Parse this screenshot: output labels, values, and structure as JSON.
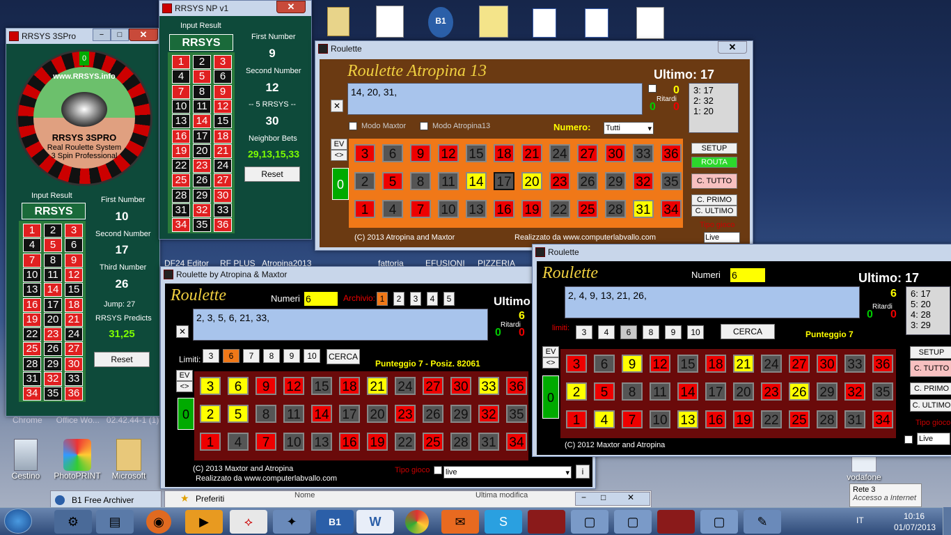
{
  "desktop": {
    "top_icons": [
      "",
      "",
      "B1",
      "",
      "",
      "",
      ""
    ],
    "labels": [
      "Cestino",
      "PhotoPRINT",
      "Microsoft",
      "vodafone",
      "fattoria",
      "EFUSIONI",
      "PIZZERIA",
      "DF24 Editor",
      "RF PLUS",
      "Atropina2013"
    ],
    "chrome_row": "Chrome      Office Wo...   02.42.44-1 (1)"
  },
  "rrsys3": {
    "title": "RRSYS 3SPro",
    "wheel_url": "www.RRSYS.info",
    "brand": "RRSYS 3SPRO",
    "tag1": "Real Roulette System",
    "tag2": "3 Spin Professional",
    "input_result": "Input Result",
    "logo": "RRSYS",
    "first_label": "First Number",
    "first": "10",
    "second_label": "Second Number",
    "second": "17",
    "third_label": "Third Number",
    "third": "26",
    "jump_label": "Jump:",
    "jump": "27",
    "predicts_label": "RRSYS Predicts",
    "predicts": "31,25",
    "reset": "Reset"
  },
  "rrsysnp": {
    "title": "RRSYS NP v1",
    "input_result": "Input Result",
    "logo": "RRSYS",
    "first_label": "First Number",
    "first": "9",
    "second_label": "Second Number",
    "second": "12",
    "mid": "-- 5 RRSYS --",
    "third": "30",
    "neighbor_label": "Neighbor Bets",
    "neighbor": "29,13,15,33",
    "reset": "Reset"
  },
  "atropina": {
    "title": "Roulette",
    "heading": "Roulette Atropina 13",
    "ultimo": "Ultimo: 17",
    "numbers": "14, 20, 31,",
    "ritardi": "Ritardi",
    "c1": "0",
    "c2": "0",
    "c3": "0",
    "history": [
      "3:  17",
      "2:  32",
      "1:  20"
    ],
    "modo_maxtor": "Modo Maxtor",
    "modo_atropina": "Modo Atropina13",
    "numero_label": "Numero:",
    "numero_value": "Tutti",
    "ev": "EV",
    "arrows": "<>",
    "zero": "0",
    "buttons": [
      "SETUP",
      "ROUTA",
      "C. TUTTO",
      "C. PRIMO",
      "C. ULTIMO"
    ],
    "tipo": "Tipo gioco",
    "live": "Live",
    "footer_left": "(C) 2013 Atropina and Maxtor",
    "footer_right": "Realizzato da www.computerlabvallo.com"
  },
  "maxtor": {
    "title": "Roulette  by  Atropina & Maxtor",
    "heading": "Roulette",
    "numeri_label": "Numeri",
    "numeri": "6",
    "archivio_label": "Archivio:",
    "archivio": [
      "1",
      "2",
      "3",
      "4",
      "5"
    ],
    "ultimo": "Ultimo",
    "numbers": "2, 3, 5, 6, 21, 33,",
    "ritardi": "Ritardi",
    "c1": "6",
    "c2": "0",
    "c3": "0",
    "limiti_label": "Limiti:",
    "limiti": [
      "3",
      "6",
      "7",
      "8",
      "9",
      "10"
    ],
    "cerca": "CERCA",
    "punteggio": "Punteggio  7   - Posiz. 82061",
    "ev": "EV",
    "arrows": "<>",
    "zero": "0",
    "footer1": "(C) 2013 Maxtor and Atropina",
    "footer2": "Realizzato da www.computerlabvallo.com",
    "tipo": "Tipo gioco",
    "live": "live",
    "info": "i"
  },
  "r3": {
    "title": "Roulette",
    "heading": "Roulette",
    "numeri_label": "Numeri",
    "numeri": "6",
    "ultimo": "Ultimo: 17",
    "numbers": "2, 4, 9, 13, 21, 26,",
    "ritardi": "Ritardi",
    "c1": "6",
    "c2": "0",
    "c3": "0",
    "history": [
      "6:  17",
      "5:  20",
      "4:  28",
      "3:  29"
    ],
    "limiti_label": "limiti:",
    "limiti": [
      "3",
      "4",
      "6",
      "8",
      "9",
      "10"
    ],
    "cerca": "CERCA",
    "punteggio": "Punteggio  7",
    "ev": "EV",
    "arrows": "<>",
    "zero": "0",
    "buttons": [
      "SETUP",
      "C. TUTTO",
      "C. PRIMO",
      "C. ULTIMO"
    ],
    "tipo": "Tipo gioco",
    "live": "Live",
    "footer": "(C) 2012 Maxtor and Atropina"
  },
  "explorer": {
    "preferiti": "Preferiti",
    "nome": "Nome",
    "ultima": "Ultima modifica"
  },
  "b1": {
    "title": "B1 Free Archiver"
  },
  "tray": {
    "lang": "IT",
    "time": "10:16",
    "date": "01/07/2013",
    "rete": "Rete  3",
    "accesso": "Accesso a Internet"
  },
  "colors": {
    "red": "#e00000",
    "grey": "#555555",
    "yellow": "#ffff00",
    "green": "#00a000",
    "brown": "#6b3a12",
    "felt": "#0e4a3a"
  }
}
